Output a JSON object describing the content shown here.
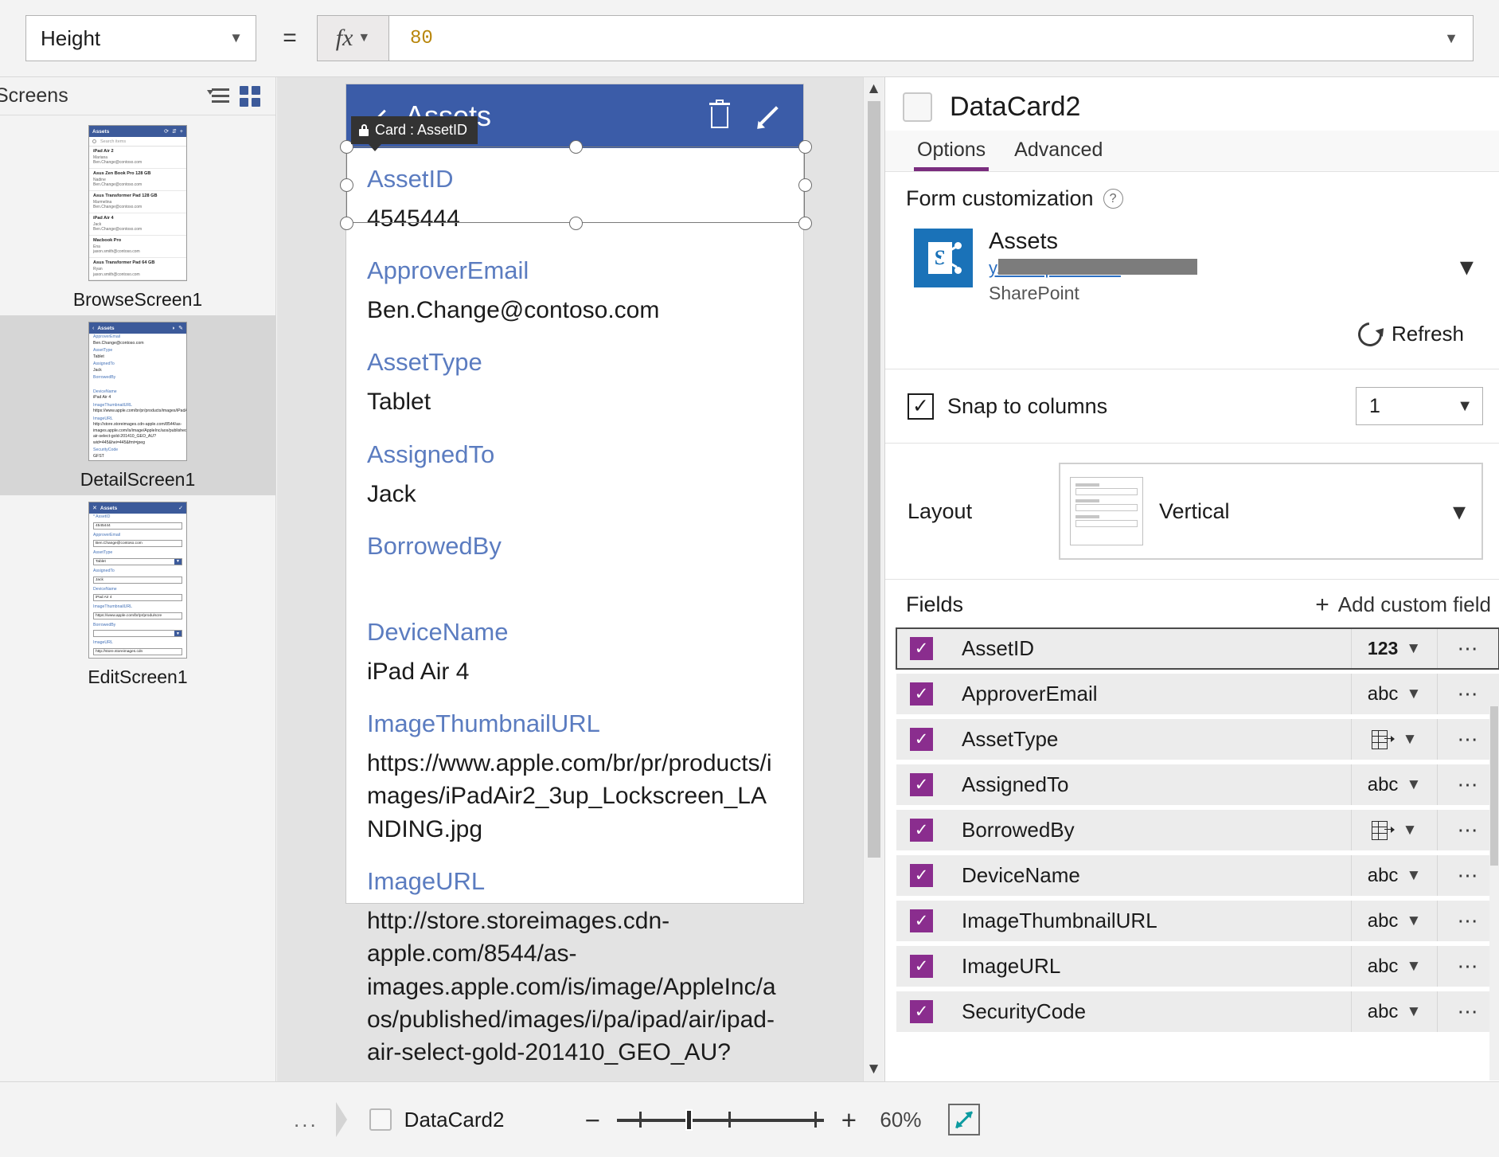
{
  "formula_bar": {
    "property": "Height",
    "property_chevron": "chevron-down",
    "equals": "=",
    "fx_label": "fx",
    "value": "80"
  },
  "sidebar": {
    "title": "Screens",
    "icons": [
      "tree-view-icon",
      "thumbnail-view-icon"
    ],
    "screens": [
      {
        "name": "BrowseScreen1",
        "selected": false,
        "thumb": {
          "header_title": "Assets",
          "header_icons": [
            "refresh-icon",
            "sort-icon",
            "add-icon"
          ],
          "search_placeholder": "Search items",
          "rows": [
            {
              "title": "iPad Air 2",
              "sub1": "Mariana",
              "sub2": "Ben.Change@contoso.com"
            },
            {
              "title": "Asus Zen Book Pro 128 GB",
              "sub1": "Nadine",
              "sub2": "Ben.Change@contoso.com"
            },
            {
              "title": "Asus Transformer Pad 128 GB",
              "sub1": "Marmelina",
              "sub2": "Ben.Change@contoso.com"
            },
            {
              "title": "iPad Air 4",
              "sub1": "Jack",
              "sub2": "Ben.Change@contoso.com"
            },
            {
              "title": "Macbook Pro",
              "sub1": "Ena",
              "sub2": "jason.smith@contoso.com"
            },
            {
              "title": "Asus Transformer Pad 64 GB",
              "sub1": "Ryan",
              "sub2": "jason.smith@contoso.com"
            }
          ]
        }
      },
      {
        "name": "DetailScreen1",
        "selected": true,
        "thumb": {
          "header_title": "Assets",
          "header_icons": [
            "back-icon",
            "trash-icon",
            "edit-icon"
          ],
          "fields": [
            {
              "key": "ApproverEmail",
              "value": "Ben.Change@contoso.com"
            },
            {
              "key": "AssetType",
              "value": "Tablet"
            },
            {
              "key": "AssignedTo",
              "value": "Jack"
            },
            {
              "key": "BorrowedBy",
              "value": ""
            },
            {
              "key": "DeviceName",
              "value": "iPad Air 4"
            },
            {
              "key": "ImageThumbnailURL",
              "value": "https://www.apple.com/br/pr/products/images/iPadAir2_3up_Lockscreen_LANDING.jpg"
            },
            {
              "key": "ImageURL",
              "value": "http://store.storeimages.cdn-apple.com/8544/as-images.apple.com/is/image/AppleInc/aos/published/images/i/pa/ipad/air/ipad-air-select-gold-201410_GEO_AU?wid=445&hei=445&fmt=jpeg"
            },
            {
              "key": "SecurityCode",
              "value": "GFST"
            }
          ]
        }
      },
      {
        "name": "EditScreen1",
        "selected": false,
        "thumb": {
          "header_title": "Assets",
          "header_icons": [
            "close-icon",
            "check-icon"
          ],
          "fields": [
            {
              "key": "* AssetID",
              "value": "4545444",
              "dropdown": false
            },
            {
              "key": "ApproverEmail",
              "value": "Ben.Change@contoso.com",
              "dropdown": false
            },
            {
              "key": "AssetType",
              "value": "Tablet",
              "dropdown": true
            },
            {
              "key": "AssignedTo",
              "value": "Jack",
              "dropdown": false
            },
            {
              "key": "DeviceName",
              "value": "iPad Air 4",
              "dropdown": false
            },
            {
              "key": "ImageThumbnailURL",
              "value": "https://www.apple.com/br/pr/produ/scre",
              "dropdown": false
            },
            {
              "key": "BorrowedBy",
              "value": "",
              "dropdown": true
            },
            {
              "key": "ImageURL",
              "value": "http://store.storeimages.cdn",
              "dropdown": false
            }
          ]
        }
      }
    ]
  },
  "canvas": {
    "tooltip": "Card : AssetID",
    "tooltip_icon": "lock-icon",
    "phone": {
      "header_title": "Assets",
      "header_icons": [
        "back-icon",
        "trash-icon",
        "edit-pencil-icon"
      ],
      "cards": [
        {
          "name": "AssetID",
          "value": "4545444"
        },
        {
          "name": "ApproverEmail",
          "value": "Ben.Change@contoso.com"
        },
        {
          "name": "AssetType",
          "value": "Tablet"
        },
        {
          "name": "AssignedTo",
          "value": "Jack"
        },
        {
          "name": "BorrowedBy",
          "value": ""
        },
        {
          "name": "DeviceName",
          "value": "iPad Air 4"
        },
        {
          "name": "ImageThumbnailURL",
          "value": "https://www.apple.com/br/pr/products/images/iPadAir2_3up_Lockscreen_LANDING.jpg"
        },
        {
          "name": "ImageURL",
          "value": "http://store.storeimages.cdn-apple.com/8544/as-images.apple.com/is/image/AppleInc/aos/published/images/i/pa/ipad/air/ipad-air-select-gold-201410_GEO_AU?"
        }
      ]
    }
  },
  "right_panel": {
    "title": "DataCard2",
    "tabs": [
      {
        "label": "Options",
        "active": true
      },
      {
        "label": "Advanced",
        "active": false
      }
    ],
    "form_customization": {
      "heading": "Form customization",
      "help_icon": "help-circle-icon",
      "datasource_name": "Assets",
      "datasource_url": "",
      "datasource_kind": "SharePoint",
      "refresh_label": "Refresh",
      "refresh_icon": "refresh-icon"
    },
    "snap_to_columns": {
      "label": "Snap to columns",
      "checked": true,
      "columns_value": "1"
    },
    "layout": {
      "label": "Layout",
      "value": "Vertical"
    },
    "fields_section": {
      "title": "Fields",
      "add_custom_field": "Add custom field",
      "fields": [
        {
          "name": "AssetID",
          "checked": true,
          "type": "123",
          "type_kind": "number",
          "selected": true
        },
        {
          "name": "ApproverEmail",
          "checked": true,
          "type": "abc",
          "type_kind": "text",
          "selected": false
        },
        {
          "name": "AssetType",
          "checked": true,
          "type": "",
          "type_kind": "lookup",
          "selected": false
        },
        {
          "name": "AssignedTo",
          "checked": true,
          "type": "abc",
          "type_kind": "text",
          "selected": false
        },
        {
          "name": "BorrowedBy",
          "checked": true,
          "type": "",
          "type_kind": "lookup",
          "selected": false
        },
        {
          "name": "DeviceName",
          "checked": true,
          "type": "abc",
          "type_kind": "text",
          "selected": false
        },
        {
          "name": "ImageThumbnailURL",
          "checked": true,
          "type": "abc",
          "type_kind": "text",
          "selected": false
        },
        {
          "name": "ImageURL",
          "checked": true,
          "type": "abc",
          "type_kind": "text",
          "selected": false
        },
        {
          "name": "SecurityCode",
          "checked": true,
          "type": "abc",
          "type_kind": "text",
          "selected": false
        }
      ]
    }
  },
  "bottom_bar": {
    "breadcrumb_dots": "...",
    "breadcrumb_name": "DataCard2",
    "zoom_out": "−",
    "zoom_in": "+",
    "zoom_level": "60%",
    "fit_icon": "fit-to-screen-icon"
  },
  "colors": {
    "phone_header": "#3b5ca8",
    "accent_purple": "#7a2d7e",
    "checkbox_purple": "#8a2d8e",
    "formula_value": "#b8860b",
    "field_label_blue": "#5b7cc0",
    "sharepoint_blue": "#1a72b8",
    "fit_teal": "#0d9ba0"
  }
}
